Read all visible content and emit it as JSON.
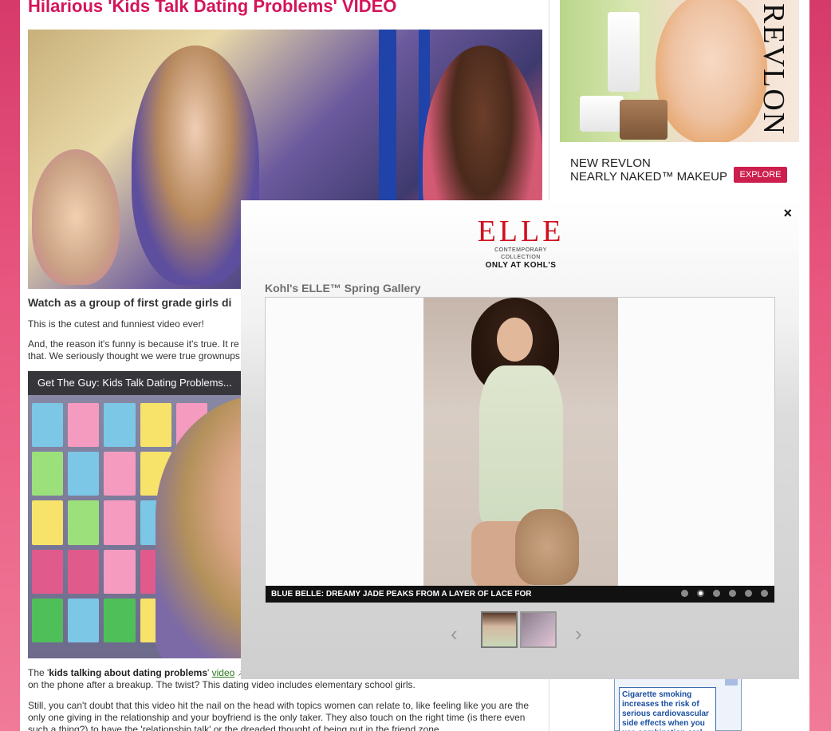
{
  "article": {
    "headline": "Hilarious 'Kids Talk Dating Problems' VIDEO",
    "subhead": "Watch as a group of first grade girls di",
    "p1": "This is the cutest and funniest video ever!",
    "p2_line1": "And, the reason it's funny is because it's true. It re",
    "p2_line2": "that. We seriously thought we were true grownups",
    "video_title": "Get The Guy: Kids Talk Dating Problems...",
    "bottom_p1_pre": "The '",
    "bottom_p1_bold": "kids talking about dating problems",
    "bottom_p1_mid": "' ",
    "bottom_p1_link": "video",
    "bottom_p1_line2": "on the phone after a breakup. The twist? This dating video includes elementary school girls.",
    "bottom_p2_line1": "Still, you can't doubt that this video hit the nail on the head with topics women can relate to, like feeling like you are the",
    "bottom_p2_line2": "only one giving in the relationship and your boyfriend is the only taker. They also touch on the right time (is there even",
    "bottom_p2_line3": "such a thing?) to have the 'relationship talk' or the dreaded thought of being put in the friend zone."
  },
  "sidebar": {
    "ad_brand": "REVLON",
    "ad_line1": "NEW REVLON",
    "ad_line2": "NEARLY NAKED™ MAKEUP",
    "ad_button": "EXPLORE",
    "box_text": "Cigarette smoking increases the risk of serious cardiovascular side effects when you use combination oral"
  },
  "modal": {
    "close_label": "×",
    "logo_main": "ELLE",
    "logo_sub": "CONTEMPORARY COLLECTION",
    "logo_kohls": "ONLY AT KOHL'S",
    "gallery_title": "Kohl's ELLE™ Spring Gallery",
    "caption": "BLUE BELLE: DREAMY JADE PEAKS FROM A LAYER OF LACE FOR",
    "prev_label": "‹",
    "next_label": "›",
    "dot_count": 6,
    "active_dot": 2
  },
  "colors": {
    "headline": "#d4145a",
    "background": "#e8577f",
    "explore_button": "#cc1f4e",
    "elle_red": "#d0101e"
  }
}
